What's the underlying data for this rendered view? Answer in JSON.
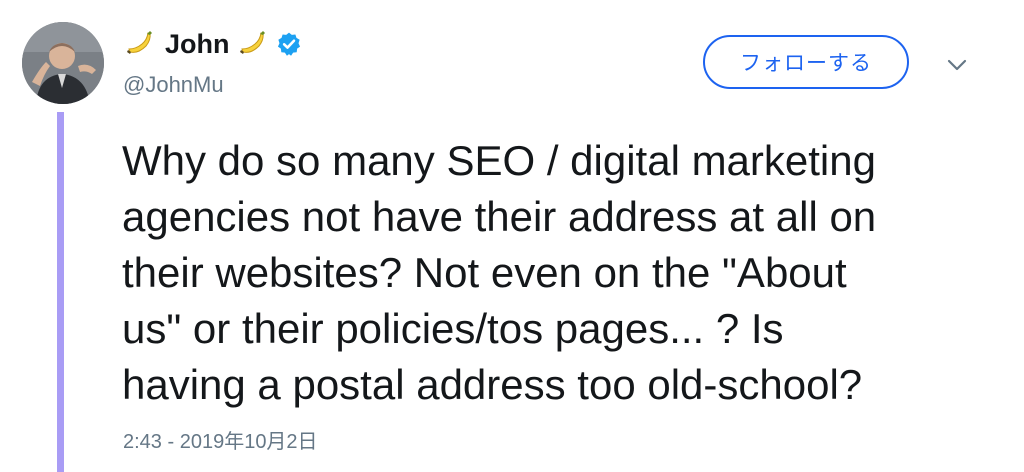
{
  "author": {
    "display_name": "John",
    "name_prefix_emoji": "banana-icon",
    "name_suffix_emoji": "banana-icon",
    "verified": true,
    "handle": "@JohnMu",
    "avatar": "avatar-photo"
  },
  "actions": {
    "follow_label": "フォローする",
    "more_icon": "chevron-down-icon"
  },
  "tweet": {
    "text": "Why do so many SEO / digital marketing\nagencies not have their address at all on\ntheir websites? Not even on the \"About\nus\" or their policies/tos pages... ? Is\nhaving a postal address too old-school?",
    "timestamp": "2:43 - 2019年10月2日"
  },
  "colors": {
    "accent": "#1d63f0",
    "verified_badge": "#1da1f2",
    "thread_line": "#a99cf5",
    "secondary_text": "#657786",
    "primary_text": "#14171a"
  }
}
